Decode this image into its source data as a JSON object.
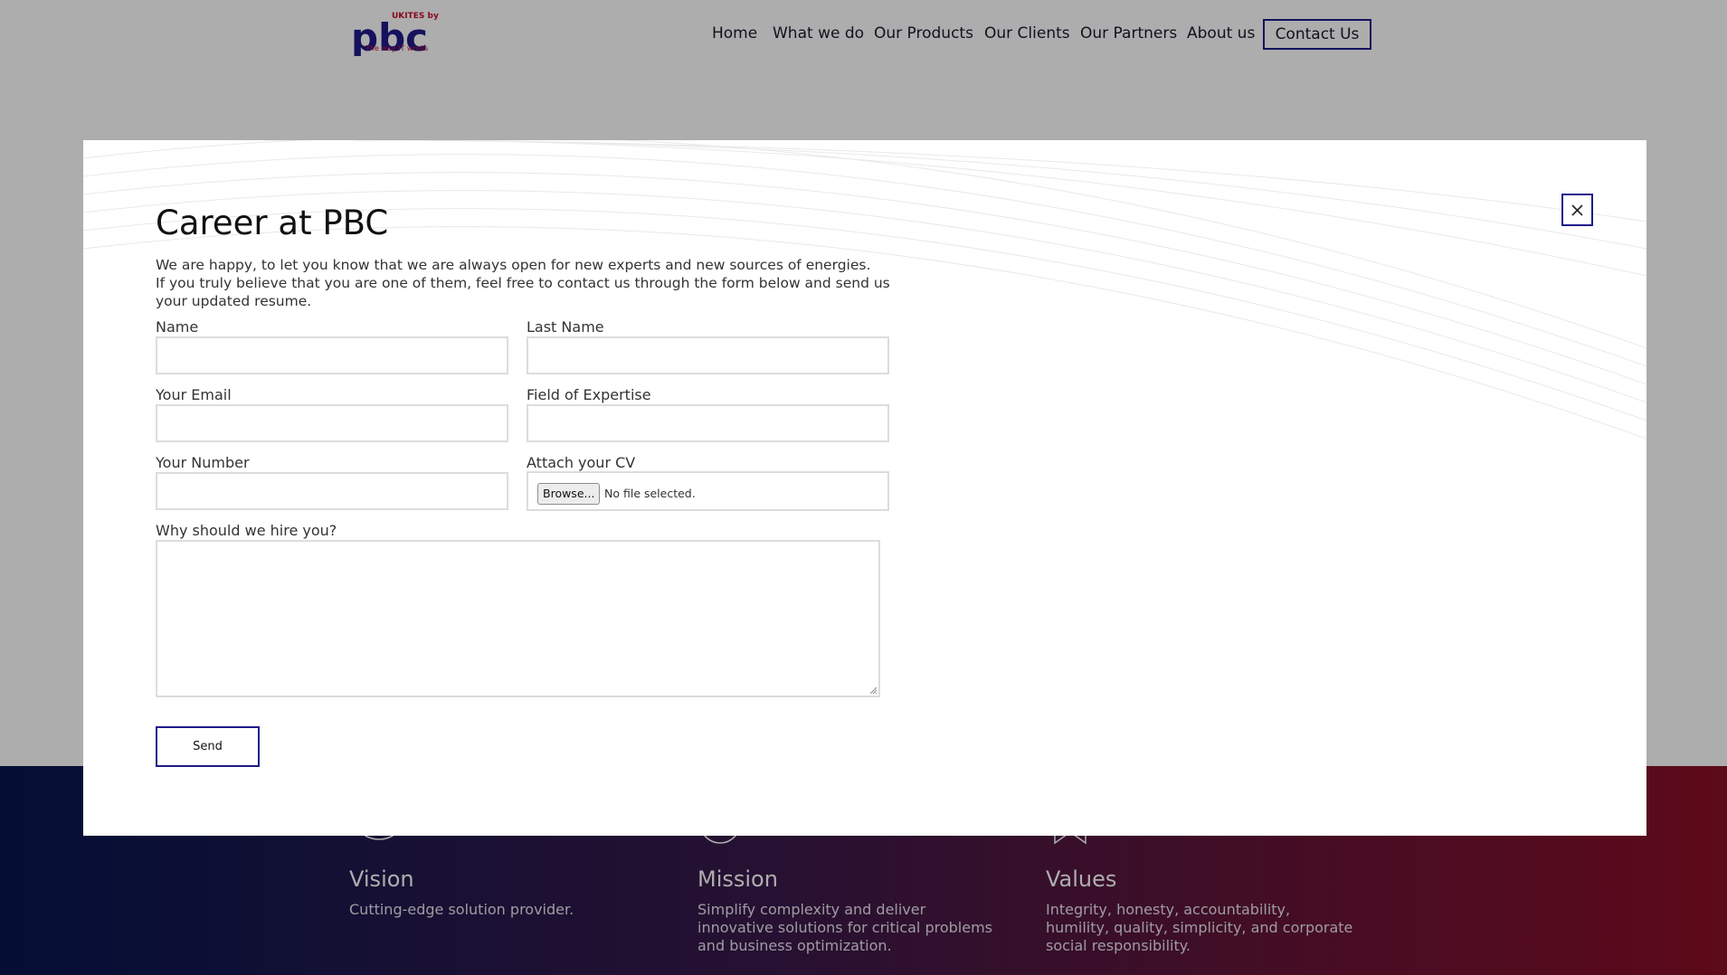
{
  "header": {
    "logo": {
      "brand": "pbc",
      "tag": "UKITES by",
      "slogan": "The way IT works"
    },
    "nav": [
      "Home",
      "What we do",
      "Our Products",
      "Our Clients",
      "Our Partners",
      "About us"
    ],
    "contact": "Contact Us"
  },
  "band": {
    "vision": {
      "title": "Vision",
      "text": "Cutting-edge solution provider.",
      "icon": "eye-icon"
    },
    "mission": {
      "title": "Mission",
      "text": "Simplify complexity and deliver innovative solutions for critical problems and business optimization.",
      "icon": "target-icon"
    },
    "values": {
      "title": "Values",
      "text": "Integrity, honesty, accountability, humility, quality, simplicity, and corporate social responsibility.",
      "icon": "star-icon"
    }
  },
  "modal": {
    "title": "Career at PBC",
    "intro": [
      "We are happy, to let you know that we are always open for new experts and new sources of energies.",
      "If you truly believe that you are one of them, feel free to contact us through the form below and send us",
      "your updated resume."
    ],
    "labels": {
      "name": "Name",
      "last_name": "Last Name",
      "email": "Your Email",
      "expertise": "Field of Expertise",
      "number": "Your Number",
      "cv": "Attach your CV",
      "why": "Why should we hire you?"
    },
    "values": {
      "name": "",
      "last_name": "",
      "email": "",
      "expertise": "",
      "number": "",
      "why": ""
    },
    "file": {
      "button": "Browse...",
      "status": "No file selected."
    },
    "send": "Send"
  },
  "colors": {
    "accent": "#1f1a8a",
    "brand_red": "#c8102e",
    "band_left": "#06164f",
    "band_right": "#8a0f26"
  }
}
